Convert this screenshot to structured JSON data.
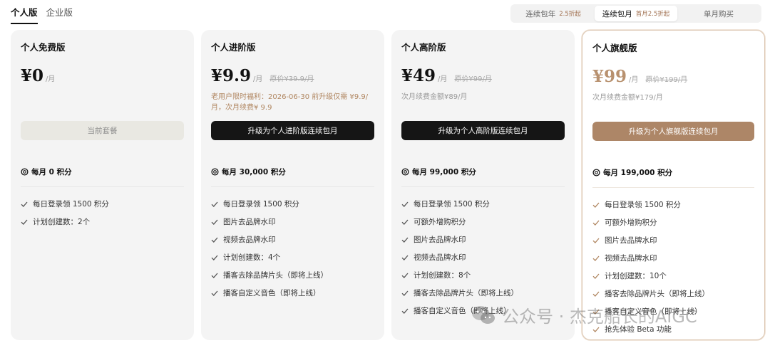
{
  "plan_tabs": [
    {
      "label": "个人版",
      "active": true
    },
    {
      "label": "企业版",
      "active": false
    }
  ],
  "billing": {
    "options": [
      {
        "label": "连续包年",
        "tag": "2.5折起",
        "active": false
      },
      {
        "label": "连续包月",
        "tag": "首月2.5折起",
        "active": true
      },
      {
        "label": "单月购买",
        "tag": "",
        "active": false
      }
    ]
  },
  "plans": [
    {
      "name": "个人免费版",
      "price": "¥0",
      "per": "/月",
      "original": "",
      "note": "",
      "cta": "当前套餐",
      "credits": "每月 0 积分",
      "features": [
        "每日登录领 1500 积分",
        "计划创建数：2个"
      ]
    },
    {
      "name": "个人进阶版",
      "price": "¥9.9",
      "per": "/月",
      "original": "原价¥39.9/月",
      "note": "老用户限时福利：2026-06-30 前升级仅需 ¥9.9/月，次月续费¥ 9.9",
      "cta": "升级为个人进阶版连续包月",
      "credits": "每月 30,000 积分",
      "features": [
        "每日登录领 1500 积分",
        "图片去品牌水印",
        "视频去品牌水印",
        "计划创建数：4个",
        "播客去除品牌片头（即将上线）",
        "播客自定义音色（即将上线）"
      ]
    },
    {
      "name": "个人高阶版",
      "price": "¥49",
      "per": "/月",
      "original": "原价¥99/月",
      "note": "次月续费金额¥89/月",
      "cta": "升级为个人高阶版连续包月",
      "credits": "每月 99,000 积分",
      "features": [
        "每日登录领 1500 积分",
        "可额外增购积分",
        "图片去品牌水印",
        "视频去品牌水印",
        "计划创建数：8个",
        "播客去除品牌片头（即将上线）",
        "播客自定义音色（即将上线）"
      ]
    },
    {
      "name": "个人旗舰版",
      "price": "¥99",
      "per": "/月",
      "original": "原价¥199/月",
      "note": "次月续费金额¥179/月",
      "cta": "升级为个人旗舰版连续包月",
      "credits": "每月 199,000 积分",
      "features": [
        "每日登录领 1500 积分",
        "可额外增购积分",
        "图片去品牌水印",
        "视频去品牌水印",
        "计划创建数：10个",
        "播客去除品牌片头（即将上线）",
        "播客自定义音色（即将上线）",
        "抢先体验 Beta 功能"
      ]
    }
  ],
  "watermark": "公众号 · 杰克船长的AIGC",
  "colors": {
    "accent_brown": "#ad8667",
    "flag_price": "#b8916f",
    "dark_button": "#151515",
    "card_bg": "#f4f4f4",
    "current_button": "#e9e8e2"
  }
}
